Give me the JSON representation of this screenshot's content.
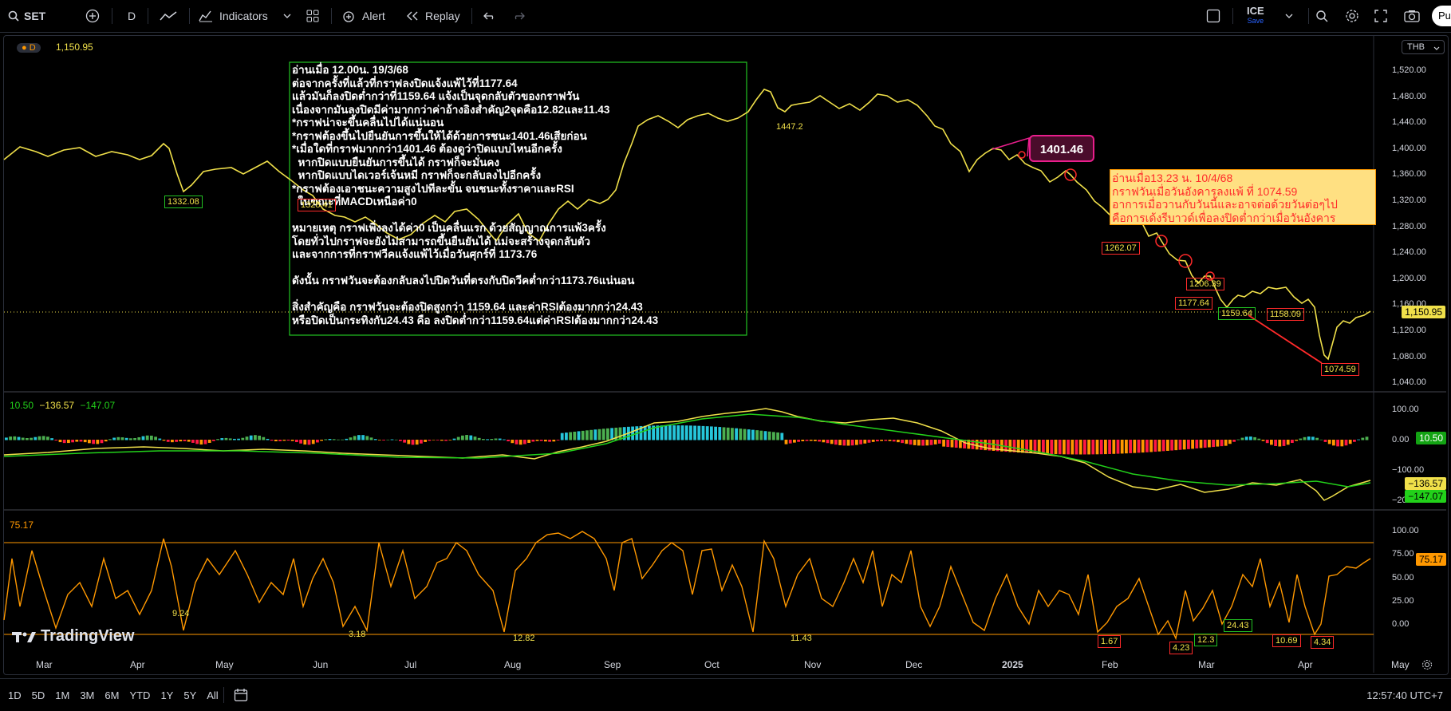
{
  "toolbar": {
    "symbol": "SET",
    "interval": "D",
    "indicators_label": "Indicators",
    "alert_label": "Alert",
    "replay_label": "Replay",
    "layout_name": "ICE",
    "layout_save": "Save",
    "publish_label": "Pu"
  },
  "chart": {
    "legend_interval": "D",
    "legend_price": "1,150.95",
    "currency": "THB",
    "price_axis": [
      "1,520.00",
      "1,480.00",
      "1,440.00",
      "1,400.00",
      "1,360.00",
      "1,320.00",
      "1,280.00",
      "1,240.00",
      "1,200.00",
      "1,160.00",
      "1,120.00",
      "1,080.00",
      "1,040.00"
    ],
    "last_price": "1,150.95",
    "price_labels": {
      "p1332": "1332.08",
      "p1447": "1447.2",
      "p1328": "1328.41",
      "p1262": "1262.07",
      "p1206": "1206.39",
      "p1177": "1177.64",
      "p1159": "1159.64",
      "p1158": "1158.09",
      "p1074": "1074.59"
    },
    "callout_1401": "1401.46"
  },
  "annotation_main": [
    "อ่านเมื่อ 12.00น. 19/3/68",
    "ต่อจากครั้งที่แล้วที่กราฟลงปิดแจ้งแพ้ไว้ที่1177.64",
    "แล้วมันก็ลงปิดต่ำกว่าที่1159.64 แจ้งเป็นจุดกลับตัวของกราฟวัน",
    "เนื่องจากมันลงปิดมีค่ามากกว่าค่าอ้างอิงสำคัญ2จุดคือ12.82และ11.43",
    "*กราฟน่าจะขึ้นคลื่นไปได้แน่นอน",
    "*กราฟต้องขึ้นไปยืนยันการขึ้นให้ได้ด้วยการชนะ1401.46เสียก่อน",
    "*เมื่อใดที่กราฟมากกว่า1401.46 ต้องดูว่าปิดแบบไหนอีกครั้ง",
    "  หากปิดแบบยืนยันการขึ้นได้ กราฟก็จะมั่นคง",
    "  หากปิดแบบไดเวอร์เจ้นหมี กราฟก็จะกลับลงไปอีกครั้ง",
    "*กราฟต้องเอาชนะความสูงไปทีละขั้น จนชนะทั้งราคาและRSI",
    "  ในขณะที่MACDเหนือค่า0",
    "",
    "หมายเหตุ กราฟเพิ่งลงได้ค่า0 เป็นคลื่นแรก ด้วยสัญญาณการแพ้3ครั้ง",
    "โดยทั่วไปกราฟจะยังไม่สามารถขึ้นยืนยันได้ แม่จะสร้างจุดกลับตัว",
    "และจากการที่กราฟวีคแจ้งแพ้ไว้เมื่อวันศุกร์ที่ 1173.76",
    "",
    "ดังนั้น กราฟวันจะต้องกลับลงไปปิดวันที่ตรงกับปิดวีคต่ำกว่า1173.76แน่นอน",
    "",
    "สิ่งสำคัญคือ กราฟวันจะต้องปิดสูงกว่า 1159.64 และค่าRSIต้องมากกว่า24.43",
    "หรือปิดเป็นกระทิงกับ24.43 คือ ลงปิดต่ำกว่า1159.64แต่ค่าRSIต้องมากกว่า24.43"
  ],
  "annotation_side": [
    "อ่านเมื่อ13.23 น. 10/4/68",
    "กราฟวันเมื่อวันอังคารลงแพ้ ที่ 1074.59",
    "อาการเมื่อวานกับวันนี้และอาจต่อด้วยวันต่อๆไป",
    "คือการเด้งรีบาวด์เพื่อลงปิดต่ำกว่าเมื่อวันอังคาร"
  ],
  "macd": {
    "legend_a": "10.50",
    "legend_b": "−136.57",
    "legend_c": "−147.07",
    "axis": [
      "100.00",
      "0.00",
      "−100.00",
      "−200.00"
    ],
    "tag_hist": "10.50",
    "tag_macd": "−136.57",
    "tag_signal": "−147.07"
  },
  "rsi": {
    "legend": "75.17",
    "axis": [
      "100.00",
      "75.00",
      "50.00",
      "25.00",
      "0.00"
    ],
    "tag": "75.17",
    "labels": {
      "r924": "9.24",
      "r318": "3.18",
      "r1282": "12.82",
      "r1143": "11.43",
      "r167": "1.67",
      "r423": "4.23",
      "r123": "12.3",
      "r2443": "24.43",
      "r1069": "10.69",
      "r434": "4.34"
    }
  },
  "x_axis": [
    "Mar",
    "Apr",
    "May",
    "Jun",
    "Jul",
    "Aug",
    "Sep",
    "Oct",
    "Nov",
    "Dec",
    "2025",
    "Feb",
    "Mar",
    "Apr",
    "May"
  ],
  "watermark": "TradingView",
  "bottombar": {
    "ranges": [
      "1D",
      "5D",
      "1M",
      "3M",
      "6M",
      "YTD",
      "1Y",
      "5Y",
      "All"
    ],
    "clock": "12:57:40 UTC+7"
  },
  "colors": {
    "price_line": "#f0e04a",
    "rsi_line": "#ff9800",
    "signal_line": "#22d11a",
    "box_green": "#22c322",
    "box_red": "#ff2a2a",
    "pink": "#e91e8c"
  }
}
